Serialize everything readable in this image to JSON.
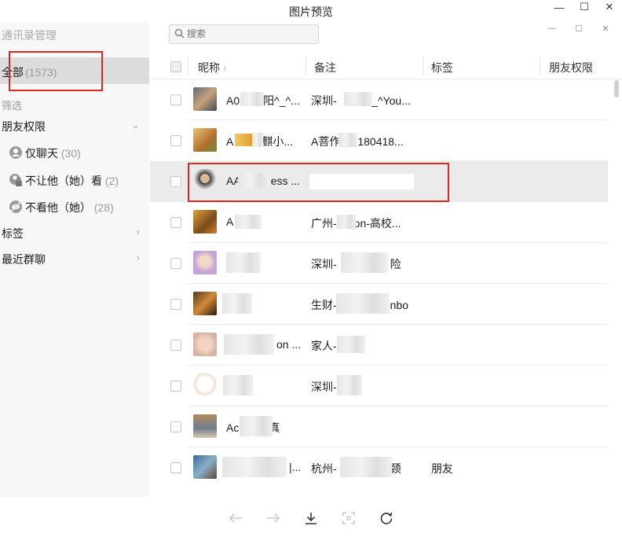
{
  "window": {
    "title": "图片预览"
  },
  "sidebar": {
    "manager": "通讯录管理",
    "all": {
      "label": "全部",
      "count": "(1573)"
    },
    "filter_label": "筛选",
    "friend_perm": "朋友权限",
    "subs": [
      {
        "label": "仅聊天",
        "count": "(30)"
      },
      {
        "label": "不让他（她）看",
        "count": "(2)"
      },
      {
        "label": "不看他（她）",
        "count": "(28)"
      }
    ],
    "tags": "标签",
    "recent_groups": "最近群聊"
  },
  "search": {
    "placeholder": "搜索"
  },
  "columns": {
    "nickname": "昵称",
    "sort_arrow": "↑",
    "remark": "备注",
    "tag": "标签",
    "perm": "朋友权限"
  },
  "rows": [
    {
      "nick": "A0",
      "nick2": "阳^_^...",
      "remark": "深圳-",
      "remark2": "^_^You...",
      "tag": ""
    },
    {
      "nick": "A",
      "nick2": "麒小...",
      "remark": "A菩作",
      "remark2": "180418...",
      "tag": ""
    },
    {
      "nick": "AA",
      "nick2": "ess ...",
      "remark": "",
      "remark2": "",
      "tag": ""
    },
    {
      "nick": "A",
      "nick2": "",
      "remark": "广州-",
      "remark2": "on-高校...",
      "tag": ""
    },
    {
      "nick": "",
      "nick2": "",
      "remark": "深圳-",
      "remark2": "险",
      "tag": ""
    },
    {
      "nick": "",
      "nick2": "",
      "remark": "生财-",
      "remark2": "nbo",
      "tag": ""
    },
    {
      "nick": "",
      "nick2": "on ...",
      "remark": "家人-",
      "remark2": "",
      "tag": ""
    },
    {
      "nick": "",
      "nick2": "",
      "remark": "深圳-",
      "remark2": "",
      "tag": ""
    },
    {
      "nick": "Ac",
      "nick2": "真",
      "remark": "",
      "remark2": "",
      "tag": ""
    },
    {
      "nick": "",
      "nick2": "|...",
      "remark": "杭州-",
      "remark2": "颈",
      "tag": "朋友"
    }
  ],
  "colors": {
    "highlight": "#e0281e",
    "selected_row": "#ebebeb",
    "sidebar_bg": "#f7f7f7"
  }
}
